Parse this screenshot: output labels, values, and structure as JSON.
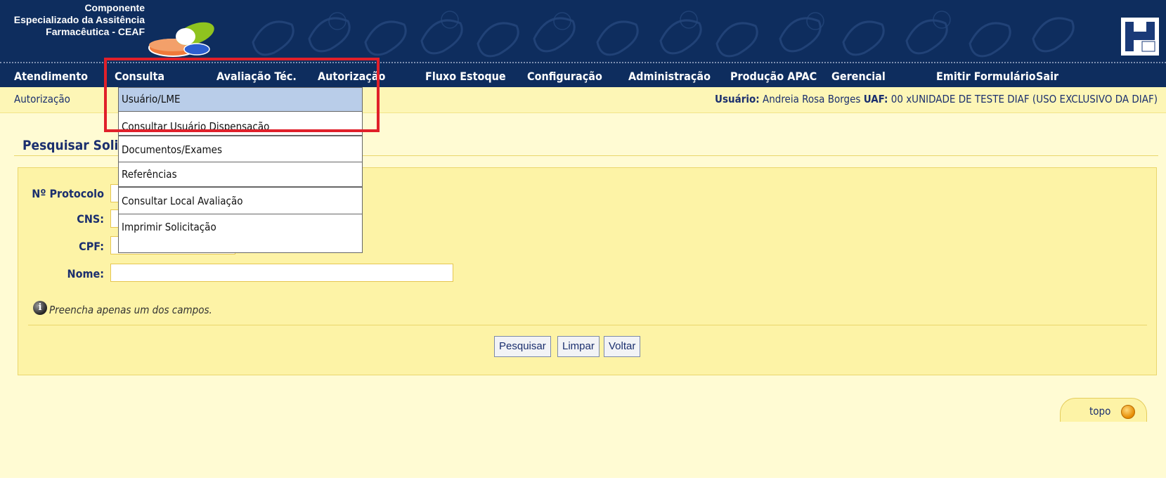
{
  "header": {
    "brand_line1": "Componente",
    "brand_line2": "Especializado da Assitência",
    "brand_line3": "Farmacêutica - CEAF"
  },
  "nav": {
    "items": [
      {
        "label": "Atendimento"
      },
      {
        "label": "Consulta"
      },
      {
        "label": "Avaliação Téc."
      },
      {
        "label": "Autorização"
      },
      {
        "label": "Fluxo Estoque"
      },
      {
        "label": "Configuração"
      },
      {
        "label": "Administração"
      },
      {
        "label": "Produção APAC"
      },
      {
        "label": "Gerencial"
      },
      {
        "label": "Emitir Formulário"
      },
      {
        "label": "Sair"
      }
    ]
  },
  "dropdown": {
    "items": [
      {
        "label": "Usuário/LME",
        "active": true
      },
      {
        "label": "Consultar Usuário Dispensação"
      },
      {
        "label": "Documentos/Exames"
      },
      {
        "label": "Referências"
      },
      {
        "label": "Consultar Local Avaliação"
      },
      {
        "label": "Imprimir Solicitação"
      }
    ]
  },
  "breadcrumb": "Autorização",
  "user": {
    "user_label": "Usuário:",
    "user_name": "Andreia Rosa Borges",
    "uaf_label": "UAF:",
    "uaf_value": "00 xUNIDADE DE TESTE DIAF (USO EXCLUSIVO DA DIAF)"
  },
  "main": {
    "title": "Pesquisar Solic",
    "fields": {
      "protocolo": {
        "label": "Nº Protocolo",
        "value": ""
      },
      "cns": {
        "label": "CNS:",
        "value": ""
      },
      "cpf": {
        "label": "CPF:",
        "value": ""
      },
      "nome": {
        "label": "Nome:",
        "value": ""
      }
    },
    "hint": "Preencha apenas um dos campos.",
    "buttons": {
      "search": "Pesquisar",
      "clear": "Limpar",
      "back": "Voltar"
    },
    "top_link": "topo"
  },
  "colors": {
    "header_bg": "#0e2d5e",
    "page_bg": "#fffbd3",
    "form_bg": "#fdf3a6",
    "label_color": "#1b2f6e",
    "menu_active": "#b9cde9",
    "highlight": "#e0202a"
  }
}
